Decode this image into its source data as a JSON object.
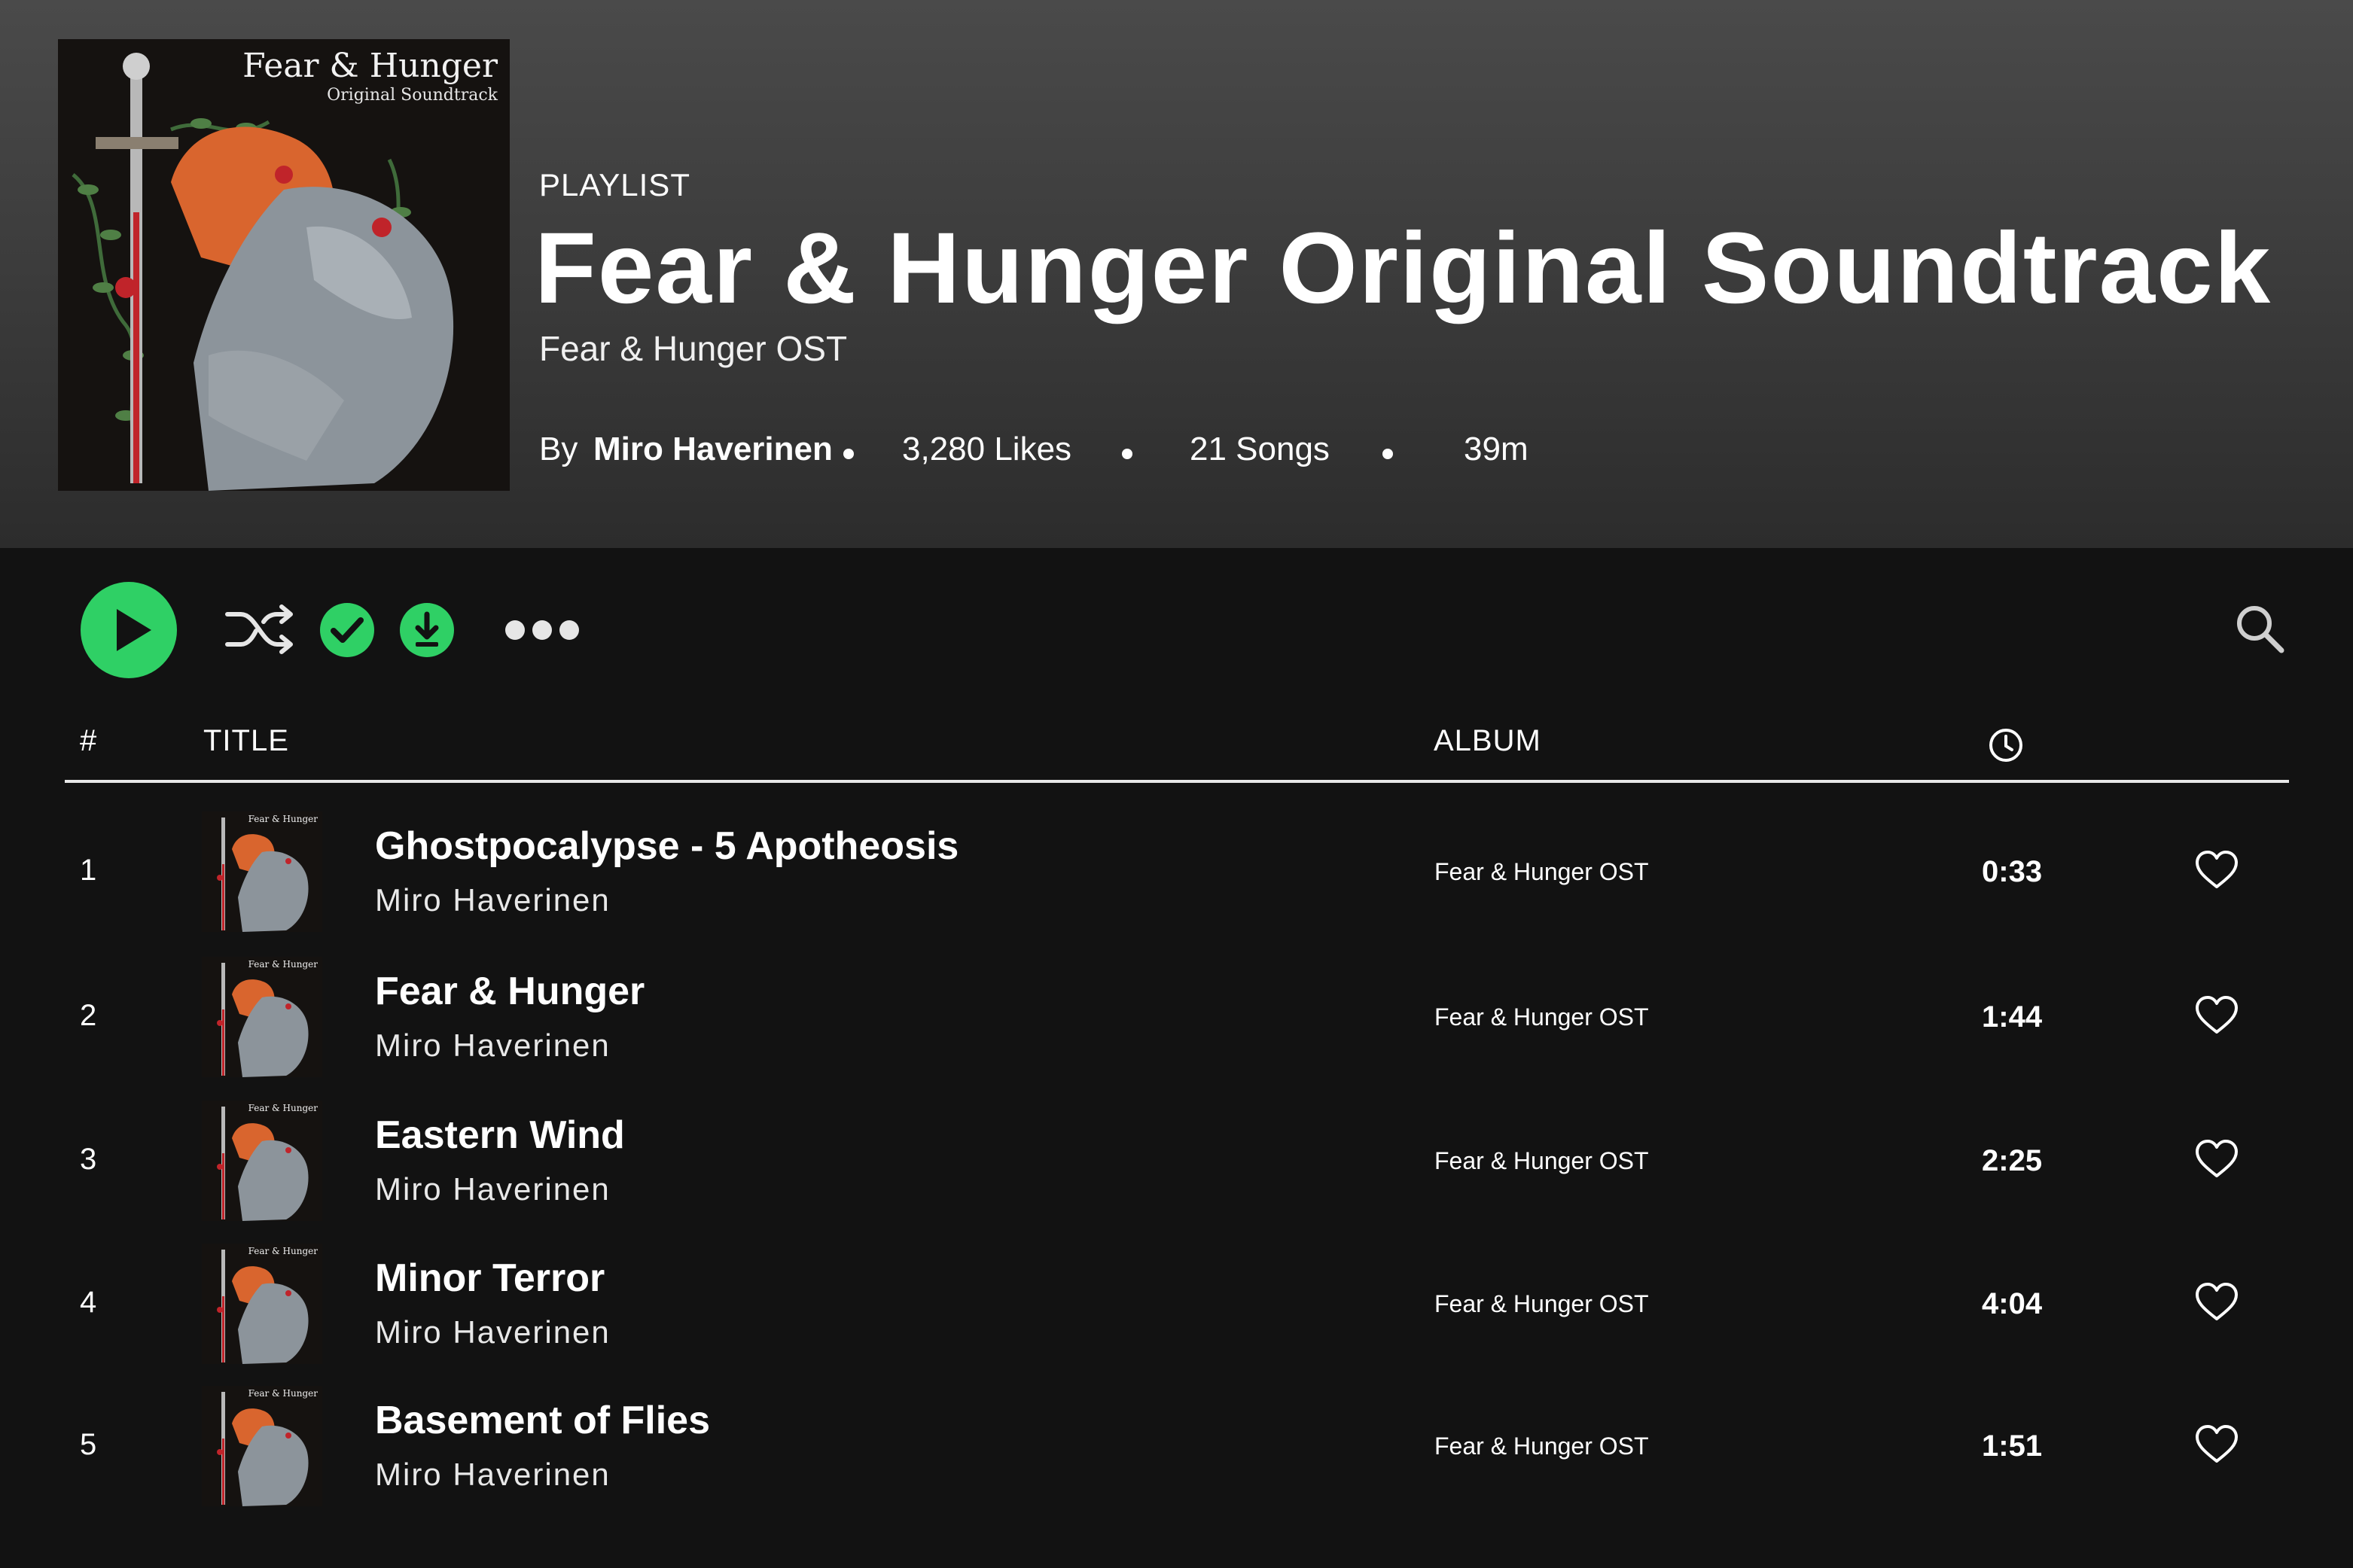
{
  "playlist": {
    "cover_title": "Fear & Hunger",
    "cover_subtitle": "Original Soundtrack",
    "kind": "PLAYLIST",
    "title": "Fear & Hunger Original Soundtrack",
    "subtitle": "Fear & Hunger OST",
    "by_label": "By",
    "owner": "Miro Haverinen",
    "likes": "3,280 Likes",
    "songs": "21 Songs",
    "duration": "39m"
  },
  "colors": {
    "accent": "#2fd065",
    "background": "#121212",
    "header": "#3c3c3c"
  },
  "toolbar": {
    "play_icon": "play-icon",
    "shuffle_icon": "shuffle-icon",
    "liked_icon": "check-icon",
    "download_icon": "download-icon",
    "more_icon": "more-icon",
    "search_icon": "search-icon"
  },
  "columns": {
    "number": "#",
    "title": "TITLE",
    "album": "ALBUM",
    "duration_icon": "clock-icon"
  },
  "tracks": [
    {
      "number": "1",
      "title": "Ghostpocalypse - 5 Apotheosis",
      "artist": "Miro Haverinen",
      "album": "Fear & Hunger OST",
      "duration": "0:33"
    },
    {
      "number": "2",
      "title": "Fear & Hunger",
      "artist": "Miro Haverinen",
      "album": "Fear & Hunger OST",
      "duration": "1:44"
    },
    {
      "number": "3",
      "title": "Eastern Wind",
      "artist": "Miro Haverinen",
      "album": "Fear & Hunger OST",
      "duration": "2:25"
    },
    {
      "number": "4",
      "title": "Minor Terror",
      "artist": "Miro Haverinen",
      "album": "Fear & Hunger OST",
      "duration": "4:04"
    },
    {
      "number": "5",
      "title": "Basement of Flies",
      "artist": "Miro Haverinen",
      "album": "Fear & Hunger OST",
      "duration": "1:51"
    }
  ]
}
